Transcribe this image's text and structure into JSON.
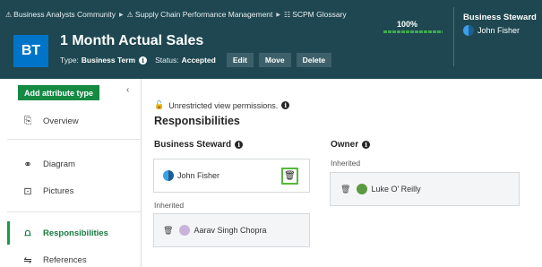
{
  "breadcrumb": {
    "items": [
      {
        "icon": "community-icon",
        "glyph": "⚠",
        "label": "Business Analysts Community"
      },
      {
        "icon": "community-icon",
        "glyph": "⚠",
        "label": "Supply Chain Performance Management"
      },
      {
        "icon": "glossary-icon",
        "glyph": "☷",
        "label": "SCPM Glossary"
      }
    ],
    "separator": "▶"
  },
  "asset": {
    "badge": "BT",
    "title": "1 Month Actual Sales",
    "type_label": "Type:",
    "type_value": "Business Term",
    "status_label": "Status:",
    "status_value": "Accepted"
  },
  "header_buttons": {
    "edit": "Edit",
    "move": "Move",
    "delete": "Delete"
  },
  "completeness": {
    "percent_label": "100%",
    "value": 1.0
  },
  "header_steward": {
    "label": "Business Steward",
    "name": "John Fisher"
  },
  "sidebar": {
    "add_attribute": "Add attribute type",
    "collapse_glyph": "‹",
    "items": [
      {
        "label": "Overview",
        "icon": "overview-icon",
        "glyph": "⎘"
      },
      {
        "label": "Diagram",
        "icon": "diagram-icon",
        "glyph": "⚭"
      },
      {
        "label": "Pictures",
        "icon": "pictures-icon",
        "glyph": "⊡"
      },
      {
        "label": "Responsibilities",
        "icon": "responsibilities-icon",
        "glyph": "⩍"
      },
      {
        "label": "References",
        "icon": "references-icon",
        "glyph": "⇋"
      }
    ]
  },
  "main": {
    "permissions": "Unrestricted view permissions.",
    "lock_glyph": "🔓",
    "section_title": "Responsibilities",
    "business_steward": {
      "title": "Business Steward",
      "direct": [
        {
          "name": "John Fisher"
        }
      ],
      "inherited_label": "Inherited",
      "inherited": [
        {
          "name": "Aarav Singh Chopra"
        }
      ]
    },
    "owner": {
      "title": "Owner",
      "inherited_label": "Inherited",
      "inherited": [
        {
          "name": "Luke O' Reilly"
        }
      ]
    },
    "trash_glyph": "🗑",
    "info_glyph": "i"
  },
  "colors": {
    "header_bg": "#1e4751",
    "badge": "#0074c8",
    "accent_green": "#148a43",
    "highlight": "#57b93b"
  }
}
